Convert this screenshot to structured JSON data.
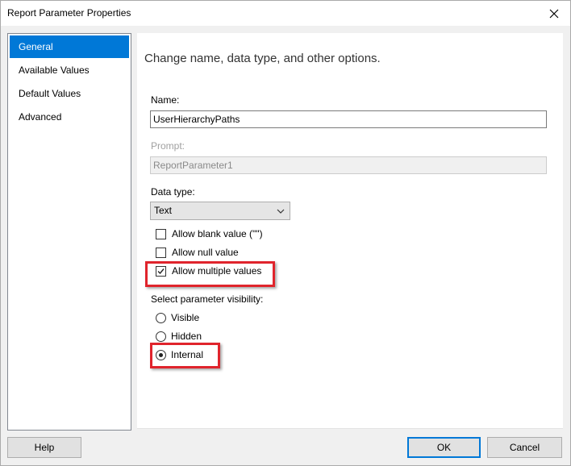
{
  "window": {
    "title": "Report Parameter Properties"
  },
  "nav": {
    "items": [
      {
        "label": "General",
        "selected": true
      },
      {
        "label": "Available Values",
        "selected": false
      },
      {
        "label": "Default Values",
        "selected": false
      },
      {
        "label": "Advanced",
        "selected": false
      }
    ]
  },
  "general": {
    "heading": "Change name, data type, and other options.",
    "name_label": "Name:",
    "name_value": "UserHierarchyPaths",
    "prompt_label": "Prompt:",
    "prompt_value": "ReportParameter1",
    "datatype_label": "Data type:",
    "datatype_value": "Text",
    "checkboxes": [
      {
        "label": "Allow blank value (\"\")",
        "checked": false
      },
      {
        "label": "Allow null value",
        "checked": false
      },
      {
        "label": "Allow multiple values",
        "checked": true
      }
    ],
    "visibility_label": "Select parameter visibility:",
    "radios": [
      {
        "label": "Visible",
        "selected": false
      },
      {
        "label": "Hidden",
        "selected": false
      },
      {
        "label": "Internal",
        "selected": true
      }
    ]
  },
  "buttons": {
    "help": "Help",
    "ok": "OK",
    "cancel": "Cancel"
  },
  "colors": {
    "selection": "#0078d7",
    "highlight": "#e0242c"
  }
}
